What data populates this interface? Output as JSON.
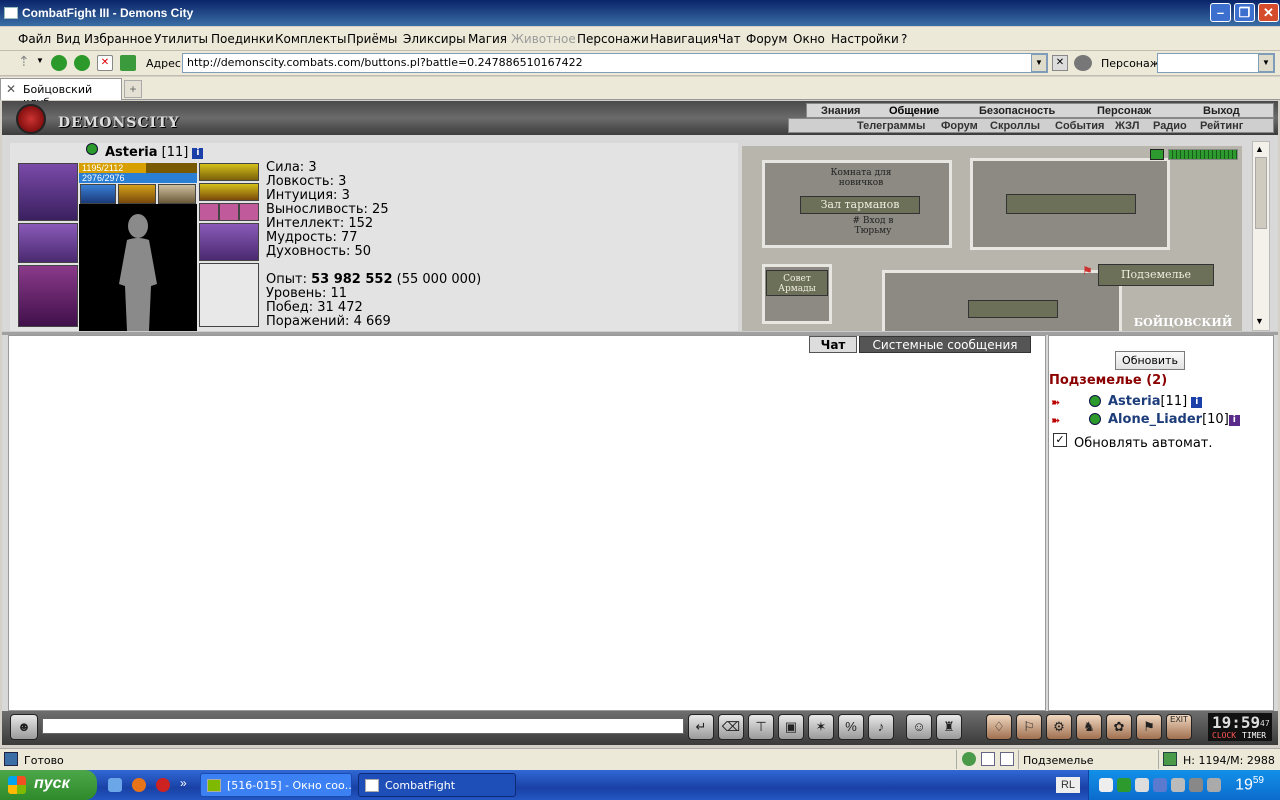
{
  "window": {
    "title": "CombatFight III - Demons City"
  },
  "menu": [
    "Файл",
    "Вид",
    "Избранное",
    "Утилиты",
    "Поединки",
    "Комплекты",
    "Приёмы",
    "Эликсиры",
    "Магия",
    "Животное",
    "Персонажи",
    "Навигация",
    "Чат",
    "Форум",
    "Окно",
    "Настройки",
    "?"
  ],
  "address": {
    "label": "Адрес:",
    "url": "http://demonscity.combats.com/buttons.pl?battle=0.247886510167422",
    "persona_label": "Персонаж:"
  },
  "tabs": {
    "active": "Бойцовский клуб"
  },
  "game": {
    "logo_text": "DEMONSCITY",
    "nav_top": [
      "Знания",
      "Общение",
      "Безопасность",
      "Персонаж",
      "Выход"
    ],
    "nav_top_active": "Общение",
    "nav_bottom": [
      "Телеграммы",
      "Форум",
      "Скроллы",
      "События",
      "ЖЗЛ",
      "Радио",
      "Рейтинг"
    ],
    "character": {
      "name": "Asteria",
      "level": "[11]",
      "hp": "1195/2112",
      "mp": "2976/2976",
      "hp_fraction": 0.566,
      "mp_fraction": 1.0
    },
    "stats": [
      "Сила: 3",
      "Ловкость: 3",
      "Интуиция: 3",
      "Выносливость: 25",
      "Интеллект: 152",
      "Мудрость: 77",
      "Духовность: 50"
    ],
    "experience": {
      "label": "Опыт:",
      "value": "53 982 552",
      "next": "(55 000 000)"
    },
    "progress": [
      "Уровень: 11",
      "Побед: 31 472",
      "Поражений: 4 669"
    ],
    "map": {
      "rooms": {
        "novice_room": "Комната для новичков",
        "tarman_hall": "Зал тарманов",
        "prison_entrance": "# Вход в Тюрьму",
        "armada_council": "Совет Армады",
        "dungeon": "Подземелье",
        "fight_club": "БОЙЦОВСКИЙ"
      },
      "signal_level": 1.0
    },
    "chat": {
      "tabs": [
        "Чат",
        "Системные сообщения"
      ],
      "active_tab": "Чат"
    },
    "sidepanel": {
      "refresh_button": "Обновить",
      "location_title": "Подземелье (2)",
      "players": [
        {
          "name": "Asteria",
          "level": "[11]"
        },
        {
          "name": "Alone_Liader",
          "level": "[10]"
        }
      ],
      "auto_refresh_label": "Обновлять автомат.",
      "auto_refresh_checked": true
    },
    "toolbar": {
      "clock_time": "19:59",
      "clock_seconds": "47",
      "clock_label": "CLOCK",
      "timer_label": "TIMER",
      "exit_label": "EXIT"
    }
  },
  "statusbar": {
    "status": "Готово",
    "location": "Подземелье",
    "hp_mp": "Н: 1194/М: 2988"
  },
  "taskbar": {
    "start": "пуск",
    "tasks": [
      "[516-015] - Окно соо...",
      "CombatFight"
    ],
    "lang": "RL",
    "time": "19",
    "time_minutes": "59"
  }
}
